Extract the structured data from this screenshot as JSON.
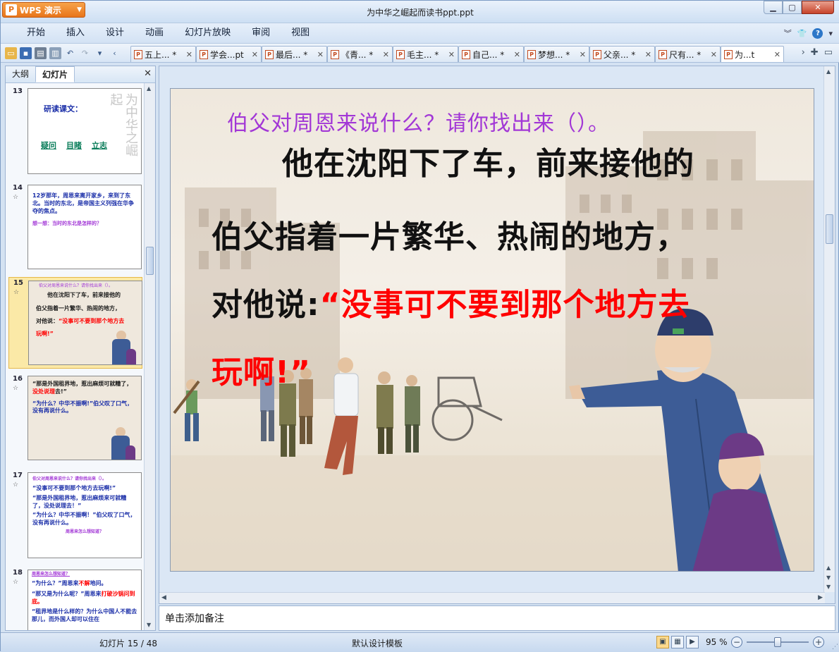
{
  "app": {
    "button_label": "WPS 演示",
    "document_title": "为中华之崛起而读书ppt.ppt",
    "window_controls": {
      "min": "▁",
      "max": "▢",
      "close": "✕"
    }
  },
  "menu": [
    "开始",
    "插入",
    "设计",
    "动画",
    "幻灯片放映",
    "审阅",
    "视图"
  ],
  "doc_tabs": [
    {
      "label": "五上... *"
    },
    {
      "label": "学会...pt"
    },
    {
      "label": "最后... *"
    },
    {
      "label": "《青... *"
    },
    {
      "label": "毛主... *"
    },
    {
      "label": "自己... *"
    },
    {
      "label": "梦想... *"
    },
    {
      "label": "父亲... *"
    },
    {
      "label": "尺有... *"
    },
    {
      "label": "为...t",
      "active": true
    }
  ],
  "left_panel": {
    "tab_outline": "大纲",
    "tab_slides": "幻灯片",
    "close": "✕",
    "thumbnails": [
      {
        "num": "13",
        "title": "研读课文：",
        "links": [
          "疑问",
          "目睹",
          "立志"
        ]
      },
      {
        "num": "14",
        "star": "☆",
        "text": "12岁那年，周恩来离开家乡，来到了东北。当时的东北，是帝国主义列强在华争夺的焦点。",
        "sub": "想一想：当时的东北是怎样的？"
      },
      {
        "num": "15",
        "star": "☆",
        "q": "伯父对周恩来说什么？请你找出来（）。",
        "l1": "他在沈阳下了车，前来接他的",
        "l2": "伯父指着一片繁华、热闹的地方，",
        "l3": "对他说：",
        "l3red": "“没事可不要到那个地方去",
        "l4red": "玩啊!”"
      },
      {
        "num": "16",
        "star": "☆",
        "l1": "“那是外国租界地，惹出麻烦可就糟了，",
        "l1red": "没处说理",
        "l1b": "去!”",
        "l2": "“为什么？中华不振啊!”伯父叹了口气，没有再说什么。"
      },
      {
        "num": "17",
        "star": "☆",
        "q": "伯父对周恩来说什么？请你找出来（）。",
        "l1": "“没事可不要到那个地方去玩啊!”",
        "l2": "“那是外国租界地，惹出麻烦来可就糟了，没处说理去！”",
        "l3": "“为什么？中华不振啊！”伯父叹了口气，没有再说什么。",
        "l4": "周恩来怎么想知道？"
      },
      {
        "num": "18",
        "star": "☆",
        "l0": "周恩来怎么想知道？",
        "l1": "“为什么？”周恩来",
        "l1red": "不解",
        "l1b": "地问。",
        "l2": "“那又是为什么呢？”周恩来",
        "l2red": "打破沙锅问到底。",
        "l3": "“租界地是什么样的？为什么中国人不能去那儿，而外国人却可以住在"
      }
    ]
  },
  "slide": {
    "question": "伯父对周恩来说什么？请你找出来（）。",
    "line1": "他在沈阳下了车，前来接他的",
    "line2": "伯父指着一片繁华、热闹的地方，",
    "line3_black": "对他说:",
    "line3_red": "“没事可不要到那个地方去",
    "line4_red": "玩啊!”"
  },
  "notes_placeholder": "单击添加备注",
  "status": {
    "slide_info": "幻灯片 15 / 48",
    "template": "默认设计模板",
    "zoom": "95 %",
    "zoom_level": 0.5
  },
  "colors": {
    "question": "#a237d6",
    "emphasis": "#ff0000",
    "accent": "#e8751a"
  }
}
